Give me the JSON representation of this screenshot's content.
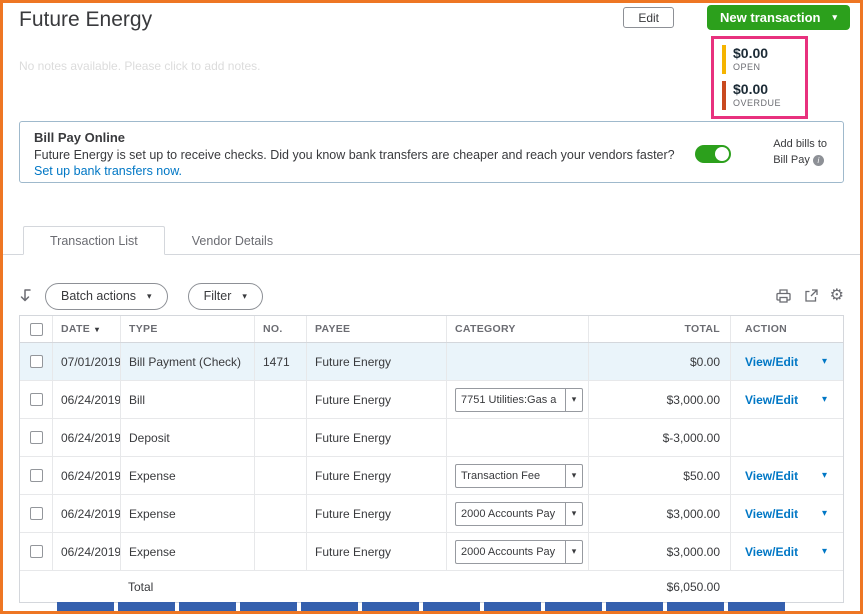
{
  "icons": {
    "chevron_down": "▾",
    "gear": "⚙",
    "info": "i",
    "sort_triangle": "▾"
  },
  "header": {
    "title": "Future Energy",
    "edit_button": "Edit",
    "new_transaction_button": "New transaction",
    "notes_placeholder": "No notes available. Please click to add notes."
  },
  "summary": {
    "open": {
      "amount": "$0.00",
      "label": "OPEN",
      "bar_color": "#F5B400"
    },
    "overdue": {
      "amount": "$0.00",
      "label": "OVERDUE",
      "bar_color": "#C9491F"
    },
    "border_color": "#E8317E"
  },
  "billpay": {
    "title": "Bill Pay Online",
    "message": "Future Energy is set up to receive checks. Did you know bank transfers are cheaper and reach your vendors faster?",
    "link": "Set up bank transfers now.",
    "toggle_on": true,
    "toggle_label_line1": "Add bills to",
    "toggle_label_line2": "Bill Pay"
  },
  "tabs": [
    {
      "label": "Transaction List",
      "active": true
    },
    {
      "label": "Vendor Details",
      "active": false
    }
  ],
  "toolbar": {
    "batch_actions_label": "Batch actions",
    "filter_label": "Filter"
  },
  "table": {
    "headers": {
      "date": "DATE",
      "type": "TYPE",
      "no": "NO.",
      "payee": "PAYEE",
      "category": "CATEGORY",
      "total": "TOTAL",
      "action": "ACTION"
    },
    "rows": [
      {
        "date": "07/01/2019",
        "type": "Bill Payment (Check)",
        "no": "1471",
        "payee": "Future Energy",
        "category": "",
        "total": "$0.00",
        "action": "View/Edit",
        "highlighted": true
      },
      {
        "date": "06/24/2019",
        "type": "Bill",
        "no": "",
        "payee": "Future Energy",
        "category": "7751 Utilities:Gas a",
        "total": "$3,000.00",
        "action": "View/Edit",
        "highlighted": false
      },
      {
        "date": "06/24/2019",
        "type": "Deposit",
        "no": "",
        "payee": "Future Energy",
        "category": "",
        "total": "$-3,000.00",
        "action": "",
        "highlighted": false
      },
      {
        "date": "06/24/2019",
        "type": "Expense",
        "no": "",
        "payee": "Future Energy",
        "category": "Transaction Fee",
        "total": "$50.00",
        "action": "View/Edit",
        "highlighted": false
      },
      {
        "date": "06/24/2019",
        "type": "Expense",
        "no": "",
        "payee": "Future Energy",
        "category": "2000 Accounts Pay",
        "total": "$3,000.00",
        "action": "View/Edit",
        "highlighted": false
      },
      {
        "date": "06/24/2019",
        "type": "Expense",
        "no": "",
        "payee": "Future Energy",
        "category": "2000 Accounts Pay",
        "total": "$3,000.00",
        "action": "View/Edit",
        "highlighted": false
      }
    ],
    "footer": {
      "label": "Total",
      "total": "$6,050.00"
    }
  },
  "colors": {
    "page_border": "#EE7623",
    "accent_green": "#2CA01C",
    "link_blue": "#0077C5",
    "row_highlight": "#EAF4FA",
    "taskbar_blue": "#3560AE"
  },
  "bottom_strip": {
    "count": 12
  }
}
